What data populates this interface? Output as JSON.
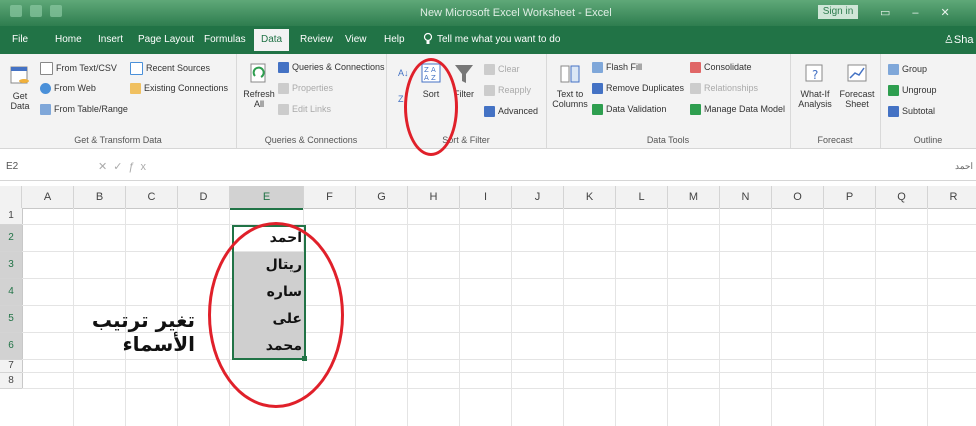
{
  "window": {
    "title": "New Microsoft Excel Worksheet - Excel",
    "signin": "Sign in"
  },
  "tabs": [
    {
      "label": "File"
    },
    {
      "label": "Home"
    },
    {
      "label": "Insert"
    },
    {
      "label": "Page Layout"
    },
    {
      "label": "Formulas"
    },
    {
      "label": "Data"
    },
    {
      "label": "Review"
    },
    {
      "label": "View"
    },
    {
      "label": "Help"
    }
  ],
  "tell_me": "Tell me what you want to do",
  "user": "Sha",
  "ribbon": {
    "get_transform": {
      "get_data": "Get Data",
      "from_text_csv": "From Text/CSV",
      "from_web": "From Web",
      "from_table_range": "From Table/Range",
      "recent_sources": "Recent Sources",
      "existing_connections": "Existing Connections",
      "label": "Get & Transform Data"
    },
    "queries": {
      "refresh_all": "Refresh All",
      "queries_connections": "Queries & Connections",
      "properties": "Properties",
      "edit_links": "Edit Links",
      "label": "Queries & Connections"
    },
    "sort_filter": {
      "sort": "Sort",
      "filter": "Filter",
      "clear": "Clear",
      "reapply": "Reapply",
      "advanced": "Advanced",
      "label": "Sort & Filter"
    },
    "data_tools": {
      "text_to_columns": "Text to Columns",
      "flash_fill": "Flash Fill",
      "remove_duplicates": "Remove Duplicates",
      "data_validation": "Data Validation",
      "consolidate": "Consolidate",
      "relationships": "Relationships",
      "manage_data_model": "Manage Data Model",
      "label": "Data Tools"
    },
    "forecast": {
      "what_if": "What-If Analysis",
      "forecast_sheet": "Forecast Sheet",
      "label": "Forecast"
    },
    "outline": {
      "group": "Group",
      "ungroup": "Ungroup",
      "subtotal": "Subtotal",
      "label": "Outline"
    }
  },
  "formula_bar": {
    "name_box": "E2",
    "value": "احمد"
  },
  "columns": [
    "A",
    "B",
    "C",
    "D",
    "E",
    "F",
    "G",
    "H",
    "I",
    "J",
    "K",
    "L",
    "M",
    "N",
    "O",
    "P",
    "Q",
    "R"
  ],
  "selected_column": "E",
  "rows": [
    "1",
    "2",
    "3",
    "4",
    "5",
    "6",
    "7",
    "8"
  ],
  "cells_e": [
    "احمد",
    "ريتال",
    "ساره",
    "على",
    "محمد"
  ],
  "caption": "تغير ترتيب الأسماء",
  "colors": {
    "excel_green": "#217346",
    "highlight_ring": "#e0202a",
    "cell_shade": "#cfcfcf"
  }
}
